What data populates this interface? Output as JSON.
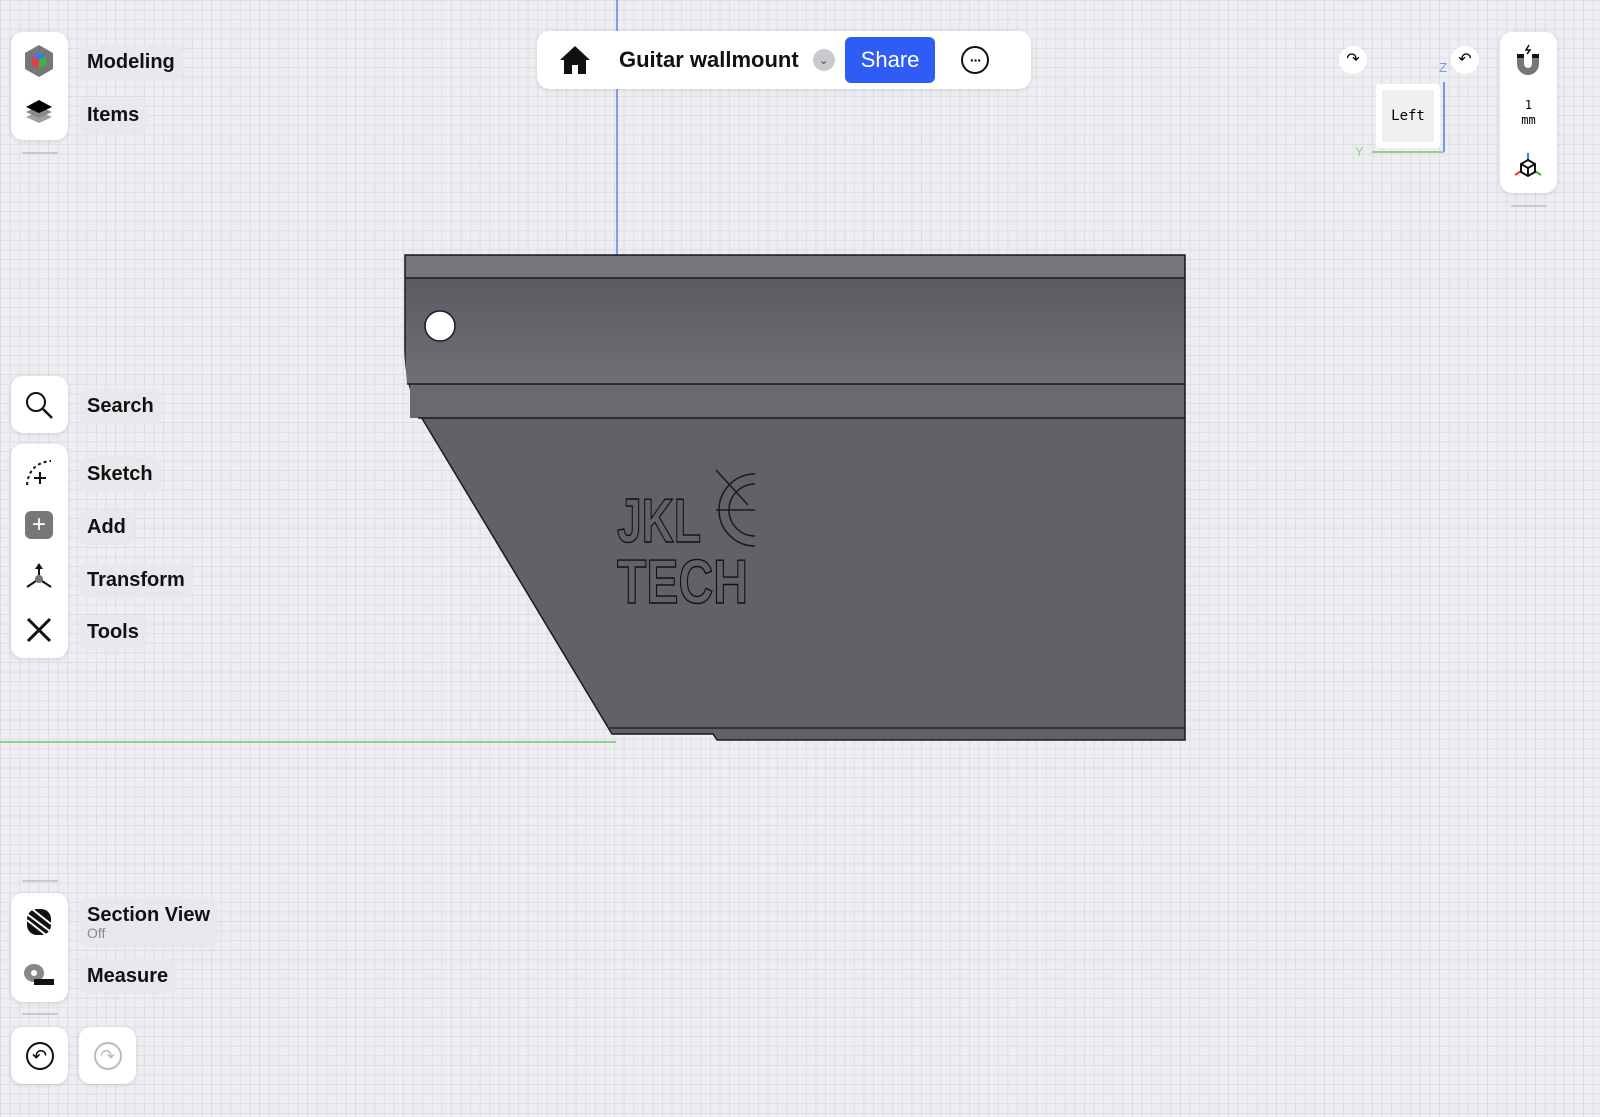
{
  "toolbar": {
    "title": "Guitar wallmount",
    "share_label": "Share"
  },
  "left": {
    "modeling": "Modeling",
    "items": "Items",
    "search": "Search",
    "sketch": "Sketch",
    "add": "Add",
    "transform": "Transform",
    "tools": "Tools",
    "section_view": "Section View",
    "section_status": "Off",
    "measure": "Measure"
  },
  "view": {
    "face": "Left",
    "axis_z": "Z",
    "axis_y": "Y"
  },
  "right": {
    "grid_value": "1",
    "grid_unit": "mm"
  },
  "model": {
    "logo_line1": "JKL",
    "logo_line2": "TECH"
  },
  "colors": {
    "accent": "#2f5cf5",
    "model": "#626166"
  }
}
